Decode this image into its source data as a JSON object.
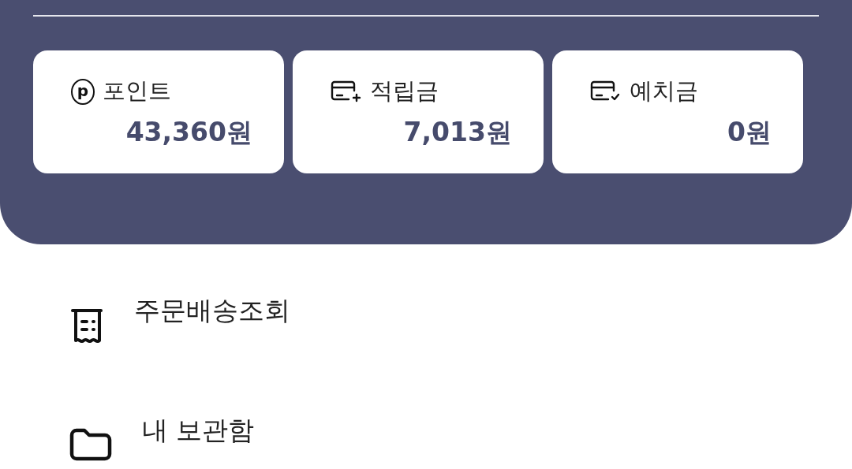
{
  "balances": [
    {
      "kind": "point",
      "icon_letter": "p",
      "label": "포인트",
      "amount": "43,360원"
    },
    {
      "kind": "reserve",
      "label": "적립금",
      "amount": "7,013원"
    },
    {
      "kind": "deposit",
      "label": "예치금",
      "amount": "0원"
    }
  ],
  "menu": [
    {
      "kind": "receipt",
      "label": "주문배송조회"
    },
    {
      "kind": "folder",
      "label": "내 보관함"
    }
  ]
}
